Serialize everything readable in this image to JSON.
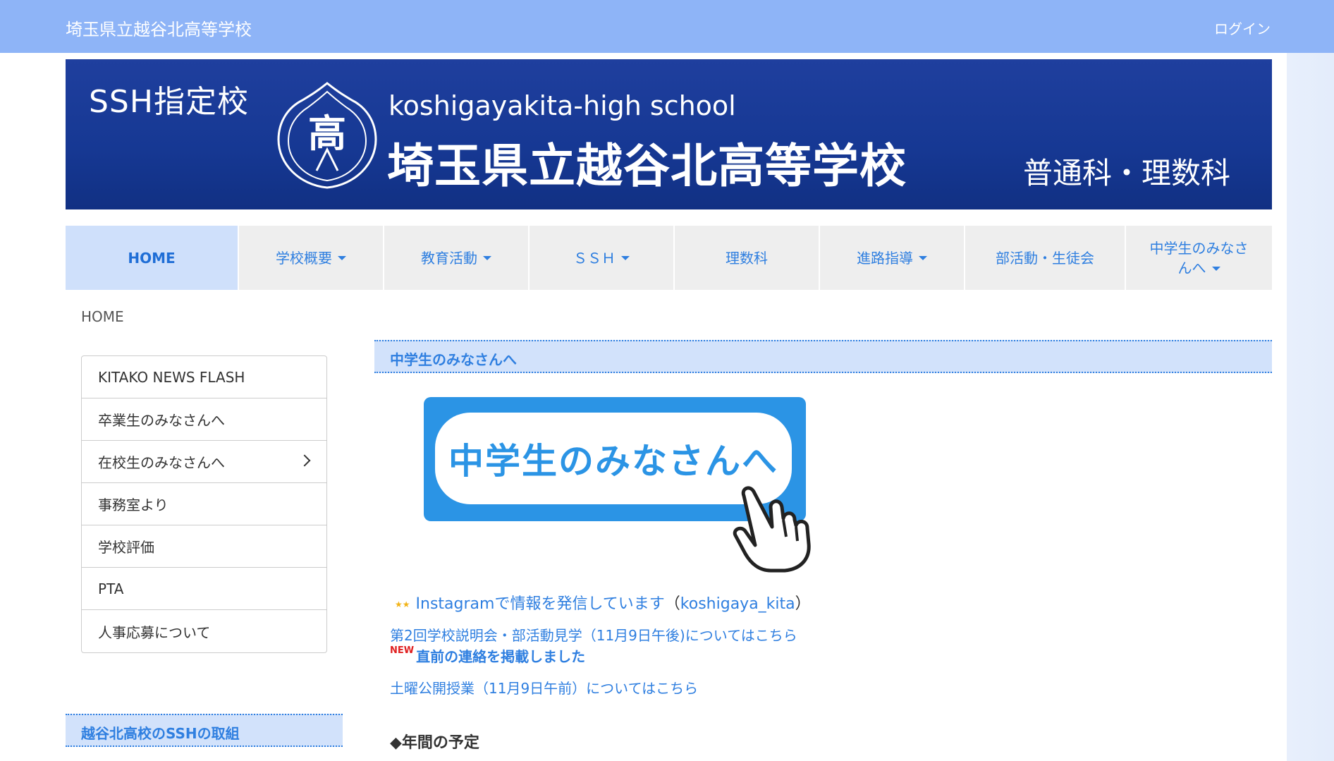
{
  "header": {
    "site_title": "埼玉県立越谷北高等学校",
    "login": "ログイン"
  },
  "banner": {
    "ssh": "SSH指定校",
    "crest_char": "高",
    "name_en": "koshigayakita-high school",
    "name_ja": "埼玉県立越谷北高等学校",
    "courses": "普通科・理数科"
  },
  "nav": {
    "items": [
      {
        "label": "HOME",
        "dropdown": false,
        "active": true
      },
      {
        "label": "学校概要",
        "dropdown": true
      },
      {
        "label": "教育活動",
        "dropdown": true
      },
      {
        "label": "ＳＳＨ",
        "dropdown": true
      },
      {
        "label": "理数科",
        "dropdown": false
      },
      {
        "label": "進路指導",
        "dropdown": true
      },
      {
        "label": "部活動・生徒会",
        "dropdown": false
      },
      {
        "label_line1": "中学生のみなさ",
        "label_line2": "んへ",
        "dropdown": true
      }
    ]
  },
  "breadcrumb": "HOME",
  "sidebar": {
    "items": [
      {
        "label": "KITAKO NEWS FLASH"
      },
      {
        "label": "卒業生のみなさんへ"
      },
      {
        "label": "在校生のみなさんへ",
        "has_submenu": true
      },
      {
        "label": "事務室より"
      },
      {
        "label": "学校評価"
      },
      {
        "label": "PTA"
      },
      {
        "label": "人事応募について"
      }
    ],
    "ssh_section_title": "越谷北高校のSSHの取組"
  },
  "main": {
    "section_title": "中学生のみなさんへ",
    "cta_text": "中学生のみなさんへ",
    "news": {
      "instagram_link": "Instagramで情報を発信しています",
      "instagram_paren_open": "（",
      "instagram_account": "koshigaya_kita",
      "instagram_paren_close": "）",
      "info_session": "第2回学校説明会・部活動見学（11月9日午後)についてはこちら",
      "new_badge": "NEW",
      "update_notice": "直前の連絡を掲載しました",
      "open_class": "土曜公開授業（11月9日午前）についてはこちら"
    },
    "annual_schedule": "◆年間の予定"
  },
  "colors": {
    "topbar": "#8eb4f7",
    "banner": "#163893",
    "accent": "#2f7fe0",
    "cta": "#2b94e5",
    "new_badge": "#e02020"
  },
  "icons": {
    "crest": "school-crest-icon",
    "submenu": "chevron-right-icon",
    "dropdown": "caret-down-icon",
    "pointer": "pointing-hand-icon",
    "stars": "stars-icon"
  }
}
